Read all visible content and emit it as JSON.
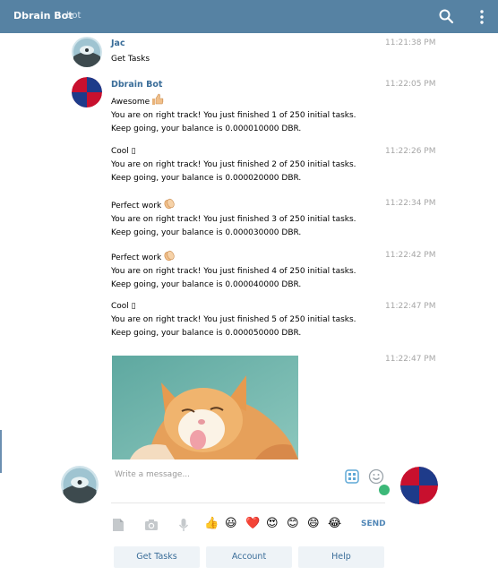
{
  "header": {
    "title": "Dbrain Bot",
    "subtitle": "bot",
    "icons": [
      "search-icon",
      "more-vertical-icon"
    ]
  },
  "messages": [
    {
      "sender": "Jac",
      "time": "11:21:38 PM",
      "lines": [
        "Get Tasks"
      ]
    },
    {
      "sender": "Dbrain Bot",
      "time": "11:22:05 PM",
      "lines": [
        "Awesome",
        "You are on right track! You just finished 1 of 250 initial tasks.",
        "Keep going, your balance is 0.000010000 DBR."
      ],
      "emoji": "thumbs-up"
    },
    {
      "time": "11:22:26 PM",
      "lines": [
        "Cool ▯",
        "You are on right track! You just finished 2 of 250 initial tasks.",
        "Keep going, your balance is 0.000020000 DBR."
      ]
    },
    {
      "time": "11:22:34 PM",
      "lines": [
        "Perfect work",
        "You are on right track! You just finished 3 of 250 initial tasks.",
        "Keep going, your balance is 0.000030000 DBR."
      ],
      "emoji": "clapping-hands"
    },
    {
      "time": "11:22:42 PM",
      "lines": [
        "Perfect work",
        "You are on right track! You just finished 4 of 250 initial tasks.",
        "Keep going, your balance is 0.000040000 DBR."
      ],
      "emoji": "clapping-hands"
    },
    {
      "time": "11:22:47 PM",
      "lines": [
        "Cool ▯",
        "You are on right track! You just finished 5 of 250 initial tasks.",
        "Keep going, your balance is 0.000050000 DBR."
      ]
    },
    {
      "time": "11:22:47 PM",
      "photo": "cat-photo"
    }
  ],
  "composer": {
    "placeholder": "Write a message...",
    "send_label": "SEND",
    "quick_emojis": [
      "👍",
      "😃",
      "❤️",
      "😍",
      "😊",
      "😄",
      "😂"
    ]
  },
  "keyboard_buttons": [
    "Get Tasks",
    "Account",
    "Help"
  ],
  "colors": {
    "header_bg": "#5682a3",
    "sender_name": "#3a6d99",
    "timestamp": "#a6a6a6",
    "send": "#5187b7",
    "keyboard_button_bg": "#eef3f7"
  }
}
